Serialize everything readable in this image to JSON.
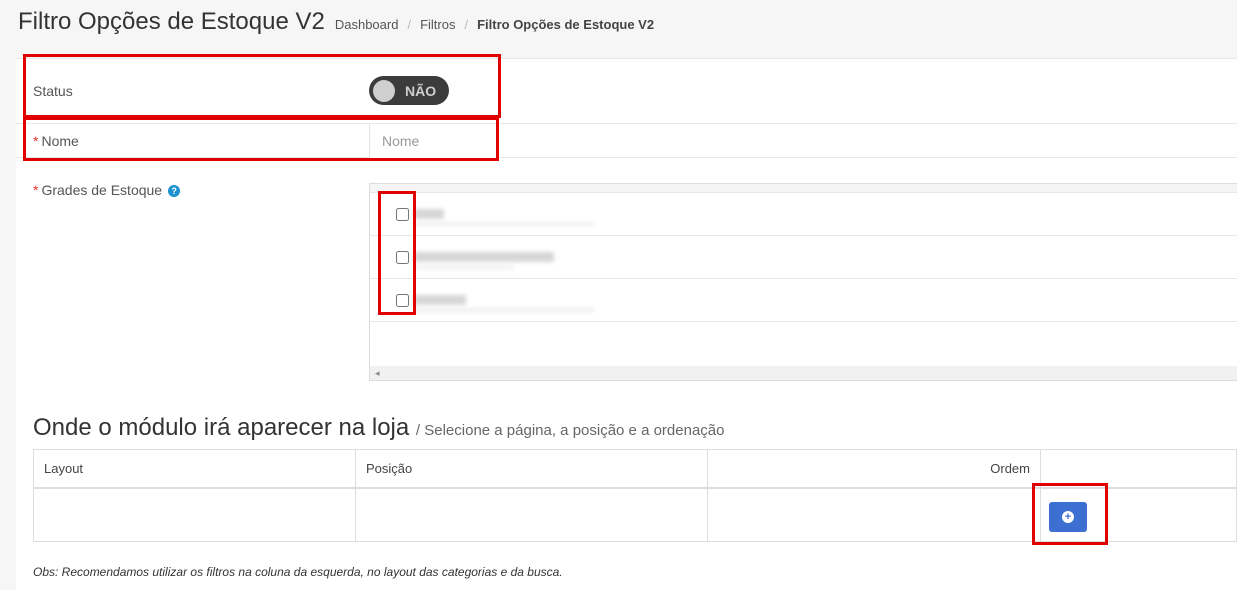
{
  "header": {
    "title": "Filtro Opções de Estoque V2",
    "breadcrumb": [
      "Dashboard",
      "Filtros",
      "Filtro Opções de Estoque V2"
    ],
    "breadcrumb_separator": "/"
  },
  "form": {
    "status": {
      "label": "Status",
      "toggle_value": "NÃO"
    },
    "nome": {
      "required_mark": "*",
      "label": "Nome",
      "placeholder": "Nome",
      "value": ""
    },
    "grades": {
      "required_mark": "*",
      "label": "Grades de Estoque",
      "help_icon": "?",
      "items": [
        {
          "checked": false
        },
        {
          "checked": false
        },
        {
          "checked": false
        }
      ],
      "scroll_arrow": "◂"
    }
  },
  "layout_section": {
    "title": "Onde o módulo irá aparecer na loja",
    "subtitle": "/ Selecione a página, a posição e a ordenação",
    "columns": [
      "Layout",
      "Posição",
      "Ordem",
      ""
    ],
    "add_icon": "plus-circle-icon"
  },
  "note": "Obs: Recomendamos utilizar os filtros na coluna da esquerda, no layout das categorias e da busca.",
  "colors": {
    "highlight": "#e00000",
    "add_button": "#3c6fd1",
    "toggle_bg": "#3c3c3c",
    "required": "#e3342f",
    "help": "#1e91cf"
  }
}
